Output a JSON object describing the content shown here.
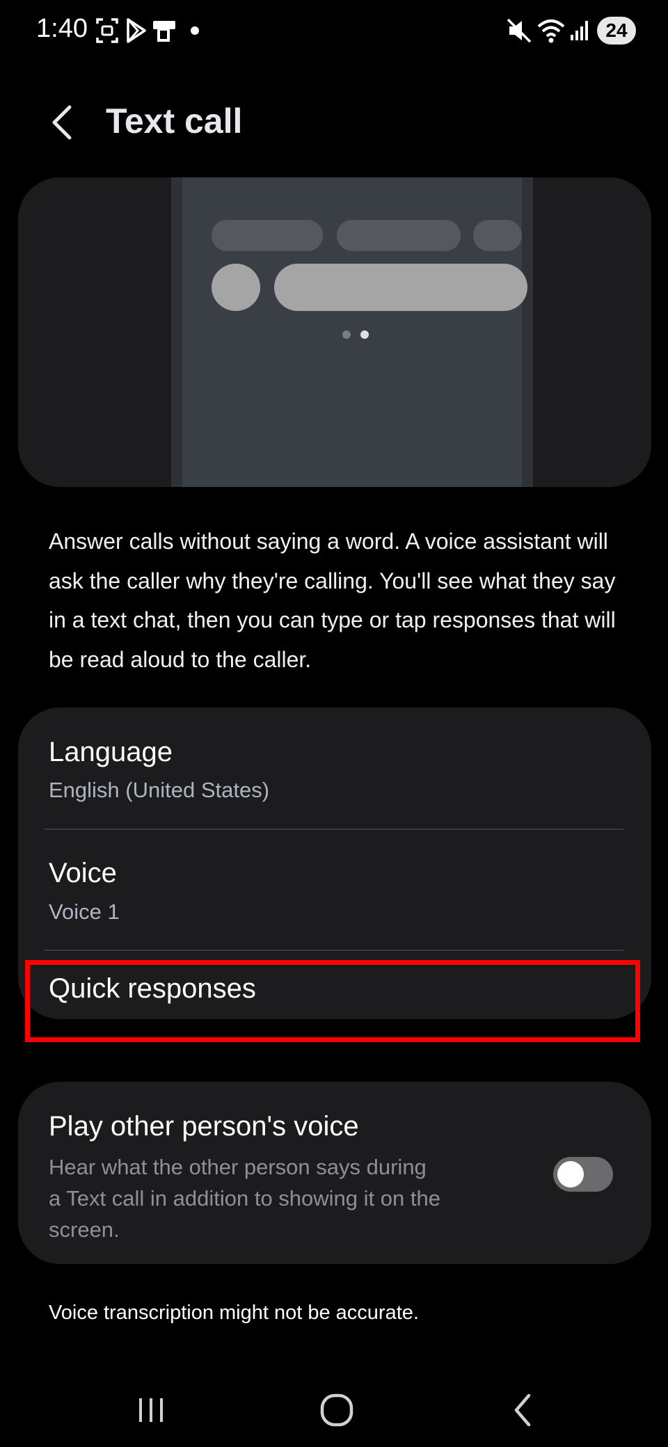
{
  "status_bar": {
    "time": "1:40",
    "battery": "24",
    "left_icons": [
      "screenshot-icon",
      "play-store-icon",
      "wallet-icon",
      "dot-icon"
    ],
    "right_icons": [
      "mute-icon",
      "wifi-icon",
      "signal-icon"
    ]
  },
  "header": {
    "title": "Text call"
  },
  "description": "Answer calls without saying a word. A voice assistant will ask the caller why they're calling. You'll see what they say in a text chat, then you can type or tap responses that will be read aloud to the caller.",
  "settings": {
    "language": {
      "title": "Language",
      "value": "English (United States)"
    },
    "voice": {
      "title": "Voice",
      "value": "Voice 1"
    },
    "quick_responses": {
      "title": "Quick responses"
    }
  },
  "play_voice": {
    "title": "Play other person's voice",
    "desc_line1": "Hear what the other person says during",
    "desc_line2": "a Text call in addition to showing it on the",
    "desc_line3": "screen.",
    "enabled": false
  },
  "footnote": "Voice transcription might not be accurate.",
  "colors": {
    "background": "#000000",
    "card": "#1c1c1e",
    "accent": "#4a86e8",
    "highlight": "#ff0000"
  }
}
